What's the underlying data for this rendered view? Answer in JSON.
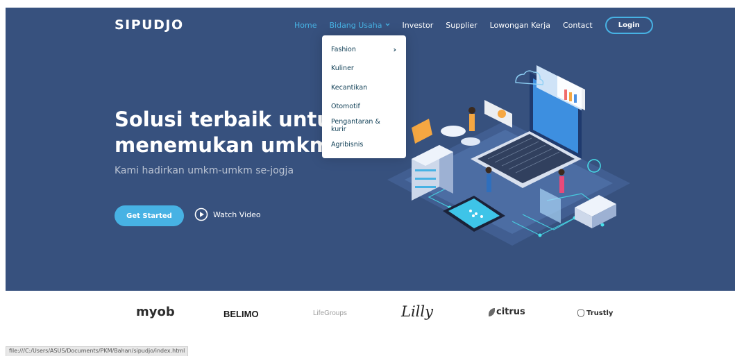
{
  "brand": {
    "logo": "SIPUDJO"
  },
  "nav": {
    "items": [
      {
        "label": "Home",
        "state": "active"
      },
      {
        "label": "Bidang Usaha",
        "state": "open"
      },
      {
        "label": "Investor",
        "state": ""
      },
      {
        "label": "Supplier",
        "state": ""
      },
      {
        "label": "Lowongan Kerja",
        "state": ""
      },
      {
        "label": "Contact",
        "state": ""
      }
    ],
    "login_label": "Login"
  },
  "dropdown": {
    "items": [
      "Fashion",
      "Kuliner",
      "Kecantikan",
      "Otomotif",
      "Pengantaran & kurir",
      "Agribisnis"
    ],
    "submenu_arrow": "›"
  },
  "hero": {
    "headline_line1": "Solusi terbaik untuk",
    "headline_line2": "menemukan umkm",
    "subtitle": "Kami hadirkan umkm-umkm se-jogja",
    "get_started_label": "Get Started",
    "watch_video_label": "Watch Video"
  },
  "clients": {
    "logos": [
      "myob",
      "BELIMO",
      "LifeGroups",
      "Lilly",
      "citrus",
      "Trustly"
    ]
  },
  "status_bar": {
    "url": "file:///C:/Users/ASUS/Documents/PKM/Bahan/sipudjo/index.html"
  },
  "colors": {
    "hero_bg": "#37517e",
    "accent": "#47b2e4",
    "dropdown_text": "#0c3c53"
  }
}
